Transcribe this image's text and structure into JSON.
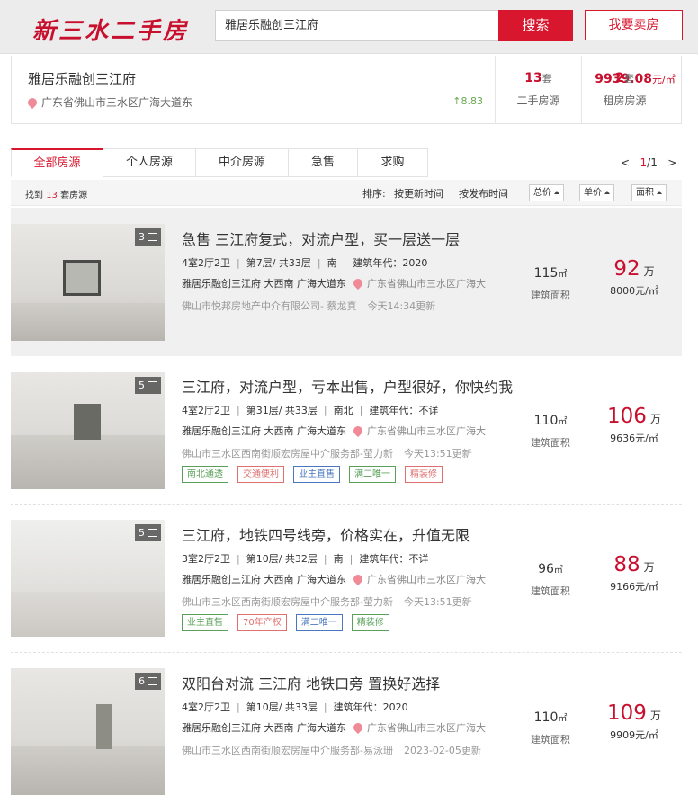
{
  "header": {
    "logo": "新三水二手房",
    "search_value": "雅居乐融创三江府",
    "search_button": "搜索",
    "sell_button": "我要卖房"
  },
  "community": {
    "name": "雅居乐融创三江府",
    "address": "广东省佛山市三水区广海大道东",
    "price": "9939.08",
    "price_unit": "元/㎡",
    "change": "↑8.83",
    "secondhand_count": "13",
    "secondhand_unit": "套",
    "secondhand_label": "二手房源",
    "rent_count": "2",
    "rent_unit": "套",
    "rent_label": "租房房源"
  },
  "tabs": [
    "全部房源",
    "个人房源",
    "中介房源",
    "急售",
    "求购"
  ],
  "pager": {
    "prev": "<",
    "current": "1",
    "total": "/1",
    "next": ">"
  },
  "toolbar": {
    "found_prefix": "找到",
    "found_count": "13",
    "found_suffix": "套房源",
    "sort_label": "排序:",
    "sort_update": "按更新时间",
    "sort_publish": "按发布时间",
    "sort_total": "总价",
    "sort_unit": "单价",
    "sort_area": "面积"
  },
  "listings": [
    {
      "photo_count": "3",
      "title": "急售 三江府复式，对流户型，买一层送一层",
      "layout": "4室2厅2卫",
      "floor": "第7层/ 共33层",
      "orientation": "南",
      "year": "建筑年代：2020",
      "community": "雅居乐融创三江府 大西南 广海大道东",
      "address": "广东省佛山市三水区广海大",
      "agent": "佛山市悦邦房地产中介有限公司- 蔡龙真",
      "updated": "今天14:34更新",
      "tags": [],
      "area": "115",
      "area_unit": "㎡",
      "area_label": "建筑面积",
      "total": "92",
      "total_unit": "万",
      "unit_price": "8000元/㎡"
    },
    {
      "photo_count": "5",
      "title": "三江府，对流户型，亏本出售，户型很好，你快约我",
      "layout": "4室2厅2卫",
      "floor": "第31层/ 共33层",
      "orientation": "南北",
      "year": "建筑年代：不详",
      "community": "雅居乐融创三江府 大西南 广海大道东",
      "address": "广东省佛山市三水区广海大",
      "agent": "佛山市三水区西南街顺宏房屋中介服务部-萤力新",
      "updated": "今天13:51更新",
      "tags": [
        {
          "text": "南北通透",
          "color": "#5aa05a"
        },
        {
          "text": "交通便利",
          "color": "#e07070"
        },
        {
          "text": "业主直售",
          "color": "#4a78c0"
        },
        {
          "text": "满二唯一",
          "color": "#5aa05a"
        },
        {
          "text": "精装修",
          "color": "#e07070"
        }
      ],
      "area": "110",
      "area_unit": "㎡",
      "area_label": "建筑面积",
      "total": "106",
      "total_unit": "万",
      "unit_price": "9636元/㎡"
    },
    {
      "photo_count": "5",
      "title": "三江府，地铁四号线旁，价格实在，升值无限",
      "layout": "3室2厅2卫",
      "floor": "第10层/ 共32层",
      "orientation": "南",
      "year": "建筑年代：不详",
      "community": "雅居乐融创三江府 大西南 广海大道东",
      "address": "广东省佛山市三水区广海大",
      "agent": "佛山市三水区西南街顺宏房屋中介服务部-萤力新",
      "updated": "今天13:51更新",
      "tags": [
        {
          "text": "业主直售",
          "color": "#5aa05a"
        },
        {
          "text": "70年产权",
          "color": "#e07070"
        },
        {
          "text": "满二唯一",
          "color": "#4a78c0"
        },
        {
          "text": "精装修",
          "color": "#5aa05a"
        }
      ],
      "area": "96",
      "area_unit": "㎡",
      "area_label": "建筑面积",
      "total": "88",
      "total_unit": "万",
      "unit_price": "9166元/㎡"
    },
    {
      "photo_count": "6",
      "title": "双阳台对流 三江府 地铁口旁 置换好选择",
      "layout": "4室2厅2卫",
      "floor": "第10层/ 共33层",
      "orientation": "",
      "year": "建筑年代：2020",
      "community": "雅居乐融创三江府 大西南 广海大道东",
      "address": "广东省佛山市三水区广海大",
      "agent": "佛山市三水区西南街顺宏房屋中介服务部-易泳珊",
      "updated": "2023-02-05更新",
      "tags": [],
      "area": "110",
      "area_unit": "㎡",
      "area_label": "建筑面积",
      "total": "109",
      "total_unit": "万",
      "unit_price": "9909元/㎡"
    }
  ]
}
